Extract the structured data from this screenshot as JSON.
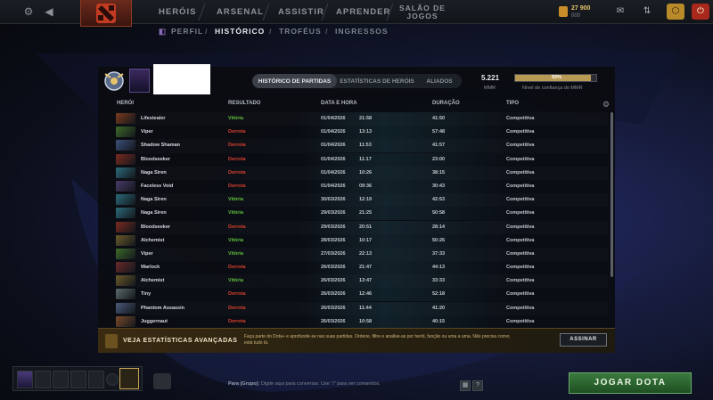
{
  "topbar": {
    "nav": [
      "HERÓIS",
      "ARSENAL",
      "ASSISTIR",
      "APRENDER"
    ],
    "arcade": [
      "SALÃO DE",
      "JOGOS"
    ],
    "gold": "27 900",
    "gold_sub": "000"
  },
  "subnav": [
    "PERFIL",
    "HISTÓRICO",
    "TROFÉUS",
    "INGRESSOS"
  ],
  "tabs": [
    "HISTÓRICO DE PARTIDAS",
    "ESTATÍSTICAS DE HERÓIS",
    "ALIADOS"
  ],
  "mmr": {
    "value": "5.221",
    "label": "MMR",
    "confidence": "93%",
    "confidence_fraction": 0.93,
    "confidence_label": "Nível de confiança do MMR"
  },
  "columns": [
    "HERÓI",
    "RESULTADO",
    "DATA E HORA",
    "DURAÇÃO",
    "TIPO"
  ],
  "matches": [
    {
      "hero": "Lifestealer",
      "result": "Vitória",
      "date": "01/04/2026",
      "time": "21:58",
      "duration": "41:50",
      "type": "Competitiva",
      "color": "#7a3a1e"
    },
    {
      "hero": "Viper",
      "result": "Derrota",
      "date": "01/04/2026",
      "time": "13:13",
      "duration": "57:48",
      "type": "Competitiva",
      "color": "#3c6a2a"
    },
    {
      "hero": "Shadow Shaman",
      "result": "Derrota",
      "date": "01/04/2026",
      "time": "11:53",
      "duration": "41:57",
      "type": "Competitiva",
      "color": "#3b4f7a"
    },
    {
      "hero": "Bloodseeker",
      "result": "Derrota",
      "date": "01/04/2026",
      "time": "11:17",
      "duration": "23:00",
      "type": "Competitiva",
      "color": "#7a2a1e"
    },
    {
      "hero": "Naga Siren",
      "result": "Derrota",
      "date": "01/04/2026",
      "time": "10:26",
      "duration": "38:15",
      "type": "Competitiva",
      "color": "#2a6a7a"
    },
    {
      "hero": "Faceless Void",
      "result": "Derrota",
      "date": "01/04/2026",
      "time": "09:36",
      "duration": "30:43",
      "type": "Competitiva",
      "color": "#4a3a6a"
    },
    {
      "hero": "Naga Siren",
      "result": "Vitória",
      "date": "30/03/2026",
      "time": "12:19",
      "duration": "42:53",
      "type": "Competitiva",
      "color": "#2a6a7a"
    },
    {
      "hero": "Naga Siren",
      "result": "Vitória",
      "date": "29/03/2026",
      "time": "21:25",
      "duration": "50:58",
      "type": "Competitiva",
      "color": "#2a6a7a"
    },
    {
      "hero": "Bloodseeker",
      "result": "Derrota",
      "date": "29/03/2026",
      "time": "20:51",
      "duration": "28:14",
      "type": "Competitiva",
      "color": "#7a2a1e"
    },
    {
      "hero": "Alchemist",
      "result": "Vitória",
      "date": "28/03/2026",
      "time": "10:17",
      "duration": "50:26",
      "type": "Competitiva",
      "color": "#6a5a2a"
    },
    {
      "hero": "Viper",
      "result": "Vitória",
      "date": "27/03/2026",
      "time": "22:13",
      "duration": "37:33",
      "type": "Competitiva",
      "color": "#3c6a2a"
    },
    {
      "hero": "Warlock",
      "result": "Derrota",
      "date": "26/03/2026",
      "time": "21:47",
      "duration": "44:13",
      "type": "Competitiva",
      "color": "#6a2a2a"
    },
    {
      "hero": "Alchemist",
      "result": "Vitória",
      "date": "26/03/2026",
      "time": "13:47",
      "duration": "33:33",
      "type": "Competitiva",
      "color": "#6a5a2a"
    },
    {
      "hero": "Tiny",
      "result": "Derrota",
      "date": "26/03/2026",
      "time": "12:46",
      "duration": "52:18",
      "type": "Competitiva",
      "color": "#5a6a6a"
    },
    {
      "hero": "Phantom Assassin",
      "result": "Derrota",
      "date": "26/03/2026",
      "time": "11:44",
      "duration": "41:20",
      "type": "Competitiva",
      "color": "#4a5a7a"
    },
    {
      "hero": "Juggernaut",
      "result": "Derrota",
      "date": "26/03/2026",
      "time": "10:58",
      "duration": "40:15",
      "type": "Competitiva",
      "color": "#7a4a2a"
    }
  ],
  "banner": {
    "title": "VEJA ESTATÍSTICAS AVANÇADAS",
    "text": "Faça parte do Dota+ e aprofunde-se nas suas partidas. Ordene, filtre e analise-as por herói, função ou uma a uma. Não precisa correr, está tudo lá.",
    "button": "ASSINAR"
  },
  "chat": {
    "channel": "Para (Grupo):",
    "placeholder": "Digite aqui para conversar. Use \"/\" para ver comandos."
  },
  "play": "JOGAR DOTA",
  "icons": {
    "settings": "gear-icon",
    "back": "back-arrow-icon",
    "mail": "mail-icon",
    "inventory": "inventory-icon",
    "power": "power-icon"
  }
}
